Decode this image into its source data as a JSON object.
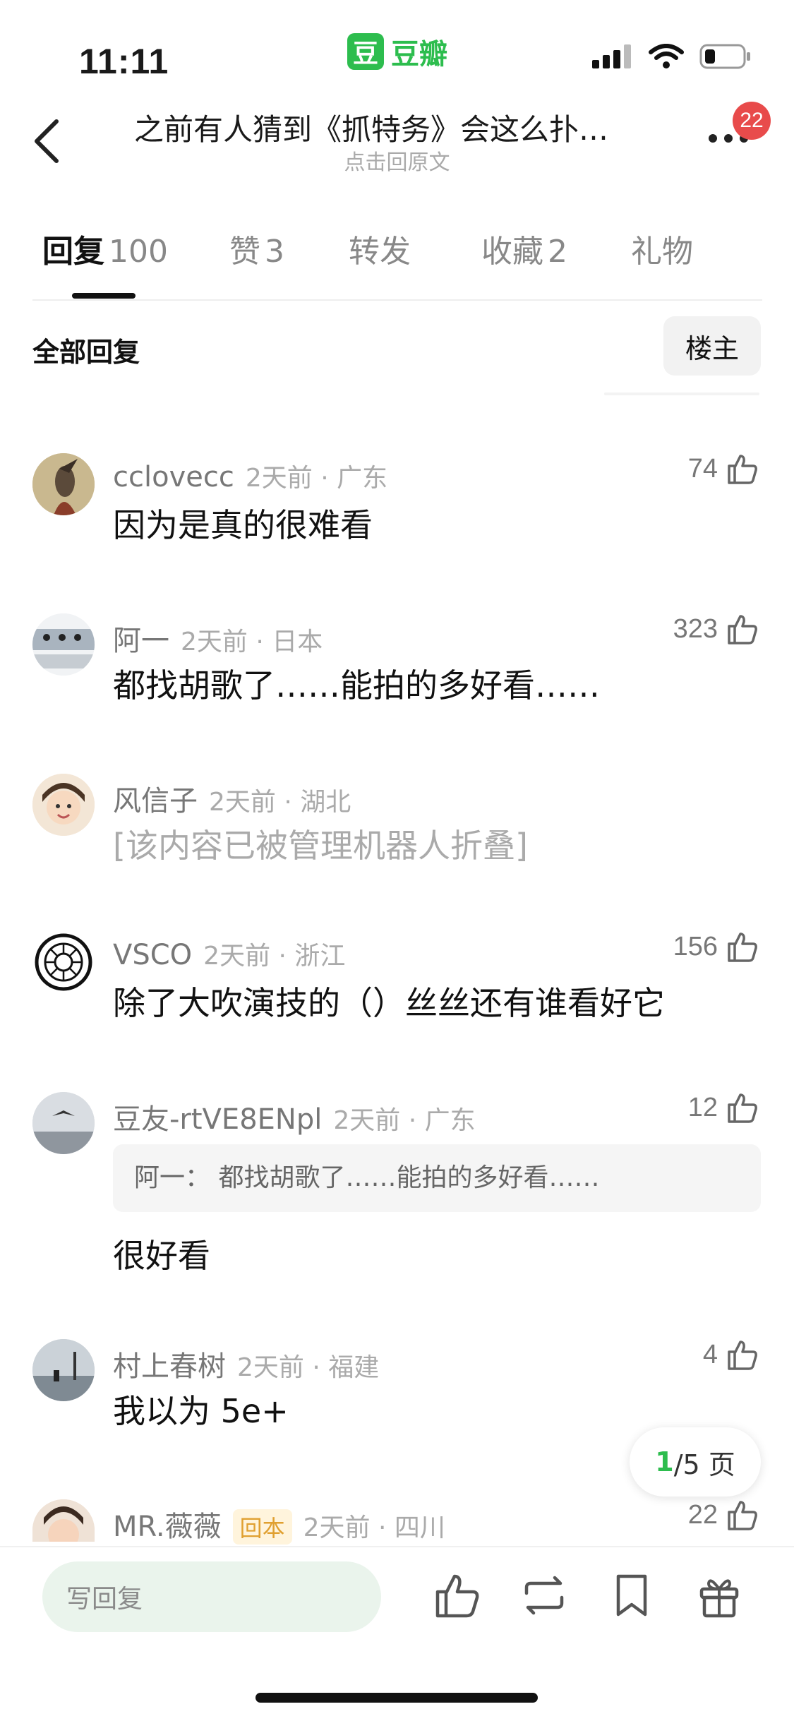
{
  "status_bar": {
    "time": "11:11"
  },
  "brand": {
    "logo_char": "豆",
    "name": "豆瓣"
  },
  "header": {
    "title": "之前有人猜到《抓特务》会这么扑…",
    "subtitle": "点击回原文",
    "notification_count": "22"
  },
  "tabs": [
    {
      "label": "回复",
      "count": "100"
    },
    {
      "label": "赞",
      "count": "3"
    },
    {
      "label": "转发",
      "count": ""
    },
    {
      "label": "收藏",
      "count": "2"
    },
    {
      "label": "礼物",
      "count": ""
    }
  ],
  "filter": {
    "label": "全部回复",
    "op_button": "楼主"
  },
  "comments": [
    {
      "user": "cclovecc",
      "time_location": "2天前 · 广东",
      "likes": "74",
      "text": "因为是真的很难看"
    },
    {
      "user": "阿一",
      "time_location": "2天前 · 日本",
      "likes": "323",
      "text": "都找胡歌了……能拍的多好看……"
    },
    {
      "user": "风信子",
      "time_location": "2天前 · 湖北",
      "likes": "",
      "text": "[该内容已被管理机器人折叠]"
    },
    {
      "user": "VSCO",
      "time_location": "2天前 · 浙江",
      "likes": "156",
      "text": "除了大吹演技的（）丝丝还有谁看好它"
    },
    {
      "user": "豆友-rtVE8ENpl",
      "time_location": "2天前 · 广东",
      "likes": "12",
      "quote": "阿一： 都找胡歌了……能拍的多好看……",
      "text": "很好看"
    },
    {
      "user": "村上春树",
      "time_location": "2天前 · 福建",
      "likes": "4",
      "text": "我以为 5e+"
    },
    {
      "user": "MR.薇薇",
      "tag": "回本",
      "time_location": "2天前 · 四川",
      "likes": "22",
      "text": ""
    }
  ],
  "pager": {
    "current": "1",
    "total": "/5 页"
  },
  "bottom_bar": {
    "reply_placeholder": "写回复"
  },
  "colors": {
    "brand_green": "#2dbd4e",
    "badge_red": "#e84b4b"
  }
}
